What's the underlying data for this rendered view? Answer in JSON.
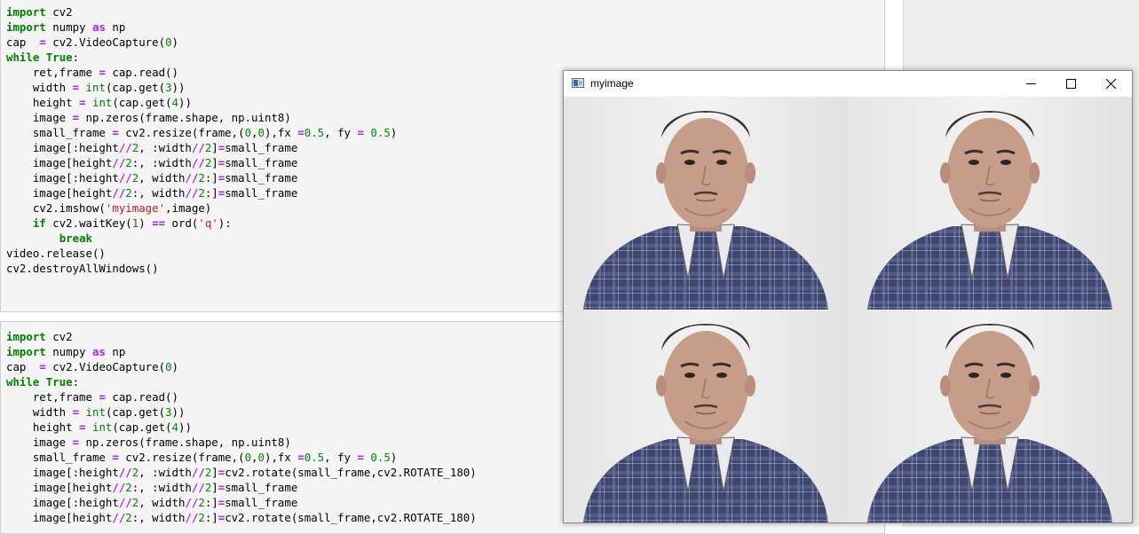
{
  "notebook": {
    "cell1_lines": [
      "import cv2",
      "import numpy as np",
      "cap  = cv2.VideoCapture(0)",
      "while True:",
      "    ret,frame = cap.read()",
      "    width = int(cap.get(3))",
      "    height = int(cap.get(4))",
      "    image = np.zeros(frame.shape, np.uint8)",
      "    small_frame = cv2.resize(frame,(0,0),fx =0.5, fy = 0.5)",
      "    image[:height//2, :width//2]=small_frame",
      "    image[height//2:, :width//2]=small_frame",
      "    image[:height//2, width//2:]=small_frame",
      "    image[height//2:, width//2:]=small_frame",
      "    cv2.imshow('myimage',image)",
      "    if cv2.waitKey(1) == ord('q'):",
      "        break",
      "video.release()",
      "cv2.destroyAllWindows()"
    ],
    "cell2_lines": [
      "import cv2",
      "import numpy as np",
      "cap  = cv2.VideoCapture(0)",
      "while True:",
      "    ret,frame = cap.read()",
      "    width = int(cap.get(3))",
      "    height = int(cap.get(4))",
      "    image = np.zeros(frame.shape, np.uint8)",
      "    small_frame = cv2.resize(frame,(0,0),fx =0.5, fy = 0.5)",
      "    image[:height//2, :width//2]=cv2.rotate(small_frame,cv2.ROTATE_180)",
      "    image[height//2:, :width//2]=small_frame",
      "    image[:height//2, width//2:]=small_frame",
      "    image[height//2:, width//2:]=cv2.rotate(small_frame,cv2.ROTATE_180)"
    ]
  },
  "window": {
    "title": "myimage",
    "app_icon": "opencv-window-icon",
    "controls": [
      "minimize-icon",
      "maximize-icon",
      "close-icon"
    ]
  },
  "image": {
    "tiles": [
      "webcam-frame",
      "webcam-frame",
      "webcam-frame",
      "webcam-frame"
    ]
  },
  "colors": {
    "keyword": "#008000",
    "operator": "#aa22ff",
    "number": "#008800",
    "string": "#ba2121",
    "cell_background": "#f5f5f5"
  }
}
